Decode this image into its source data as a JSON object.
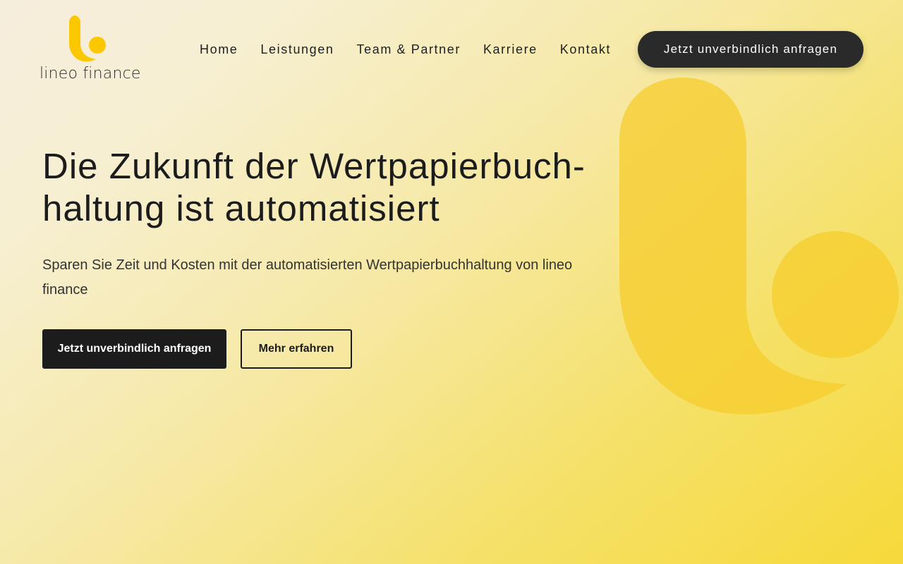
{
  "brand": {
    "name": "lineo finance",
    "logo_icon": "lineo-l-mark-icon",
    "accent": "#fbc800"
  },
  "nav": {
    "items": [
      {
        "label": "Home"
      },
      {
        "label": "Leistungen"
      },
      {
        "label": "Team & Partner"
      },
      {
        "label": "Karriere"
      },
      {
        "label": "Kontakt"
      }
    ],
    "cta_label": "Jetzt unverbindlich anfragen"
  },
  "hero": {
    "title_line1": "Die Zukunft der Wertpapierbuch-",
    "title_line2": "haltung ist automatisiert",
    "subtitle": "Sparen Sie Zeit und Kosten mit der automatisierten Wertpapierbuchhaltung von lineo finance",
    "primary_button": "Jetzt unverbindlich anfragen",
    "secondary_button": "Mehr erfahren"
  },
  "colors": {
    "dark": "#1c1c1c",
    "background_end": "#f6d93a"
  }
}
